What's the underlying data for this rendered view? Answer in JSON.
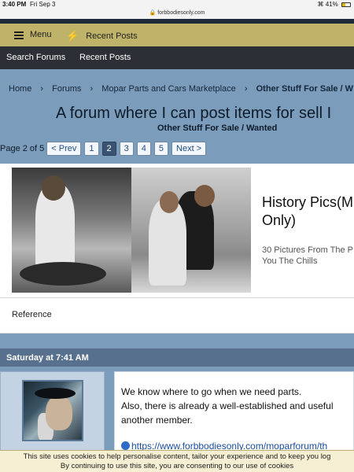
{
  "status_bar": {
    "time": "3:40 PM",
    "date": "Fri Sep 3",
    "battery": "41%",
    "battery_level": 0.41
  },
  "browser": {
    "url": "forbbodiesonly.com"
  },
  "top_nav": {
    "menu_label": "Menu",
    "recent_posts_label": "Recent Posts"
  },
  "sub_nav": {
    "search_forums_label": "Search Forums",
    "recent_posts_label": "Recent Posts"
  },
  "breadcrumb": {
    "items": [
      "Home",
      "Forums",
      "Mopar Parts and Cars Marketplace",
      "Other Stuff For Sale / W"
    ]
  },
  "thread": {
    "title": "A forum where I can post items for sell I",
    "subtitle": "Other Stuff For Sale / Wanted"
  },
  "pagination": {
    "label": "Page 2 of 5",
    "prev_label": "< Prev",
    "pages": [
      "1",
      "2",
      "3",
      "4",
      "5"
    ],
    "current_page": "2",
    "next_label": "Next >"
  },
  "ad": {
    "title": "History Pics(M Only)",
    "description": "30 Pictures From The P You The Chills",
    "reference_label": "Reference"
  },
  "post": {
    "timestamp": "Saturday at 7:41 AM",
    "lines": [
      "We know where to go when we need parts.",
      "Also, there is already a well-established and useful",
      "another member."
    ],
    "link": "https://www.forbbodiesonly.com/moparforum/th"
  },
  "cookie_notice": {
    "line1": "This site uses cookies to help personalise content, tailor your experience and to keep you log",
    "line2": "By continuing to use this site, you are consenting to our use of cookies"
  },
  "colors": {
    "nav_gold": "#bfb36a",
    "dark_nav": "#2c3036",
    "header_blue": "#7b9cba",
    "post_header": "#56708e",
    "link_blue": "#1a4fa0"
  }
}
